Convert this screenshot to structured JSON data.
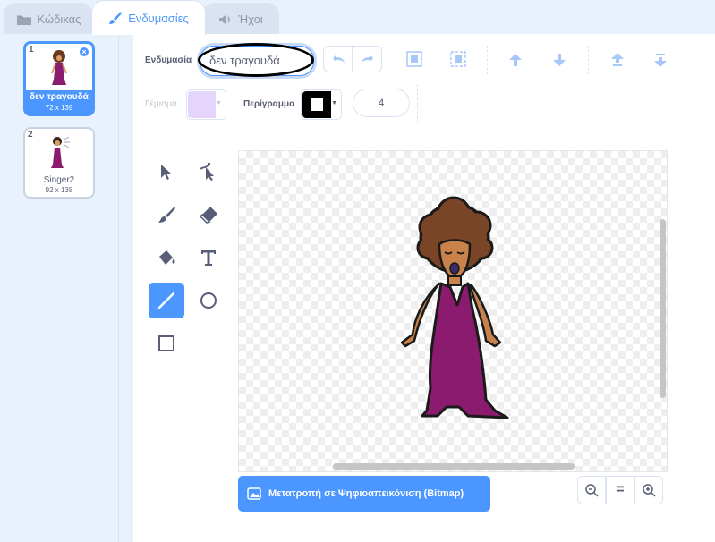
{
  "tabs": [
    {
      "label": "Κώδικας",
      "icon": "code-icon"
    },
    {
      "label": "Ενδυμασίες",
      "icon": "brush-icon"
    },
    {
      "label": "Ήχοι",
      "icon": "speaker-icon"
    }
  ],
  "costumes": [
    {
      "number": "1",
      "name": "δεν τραγουδά",
      "size": "72 x 139",
      "selected": true
    },
    {
      "number": "2",
      "name": "Singer2",
      "size": "92 x 138",
      "selected": false
    }
  ],
  "toolbar": {
    "costume_label": "Ενδυμασία",
    "costume_name": "δεν τραγουδά",
    "fill_label": "Γέμισμα",
    "outline_label": "Περίγραμμα",
    "outline_width": "4",
    "fill_color": "#e5d5fd",
    "outline_color": "#000000"
  },
  "bitmap_button": "Μετατροπή σε Ψηφιοαπεικόνιση (Bitmap)",
  "zoom": {
    "out": "zoom-out-icon",
    "reset": "=",
    "in": "zoom-in-icon"
  },
  "colors": {
    "accent": "#4c97ff",
    "background": "#e9f1fc"
  }
}
